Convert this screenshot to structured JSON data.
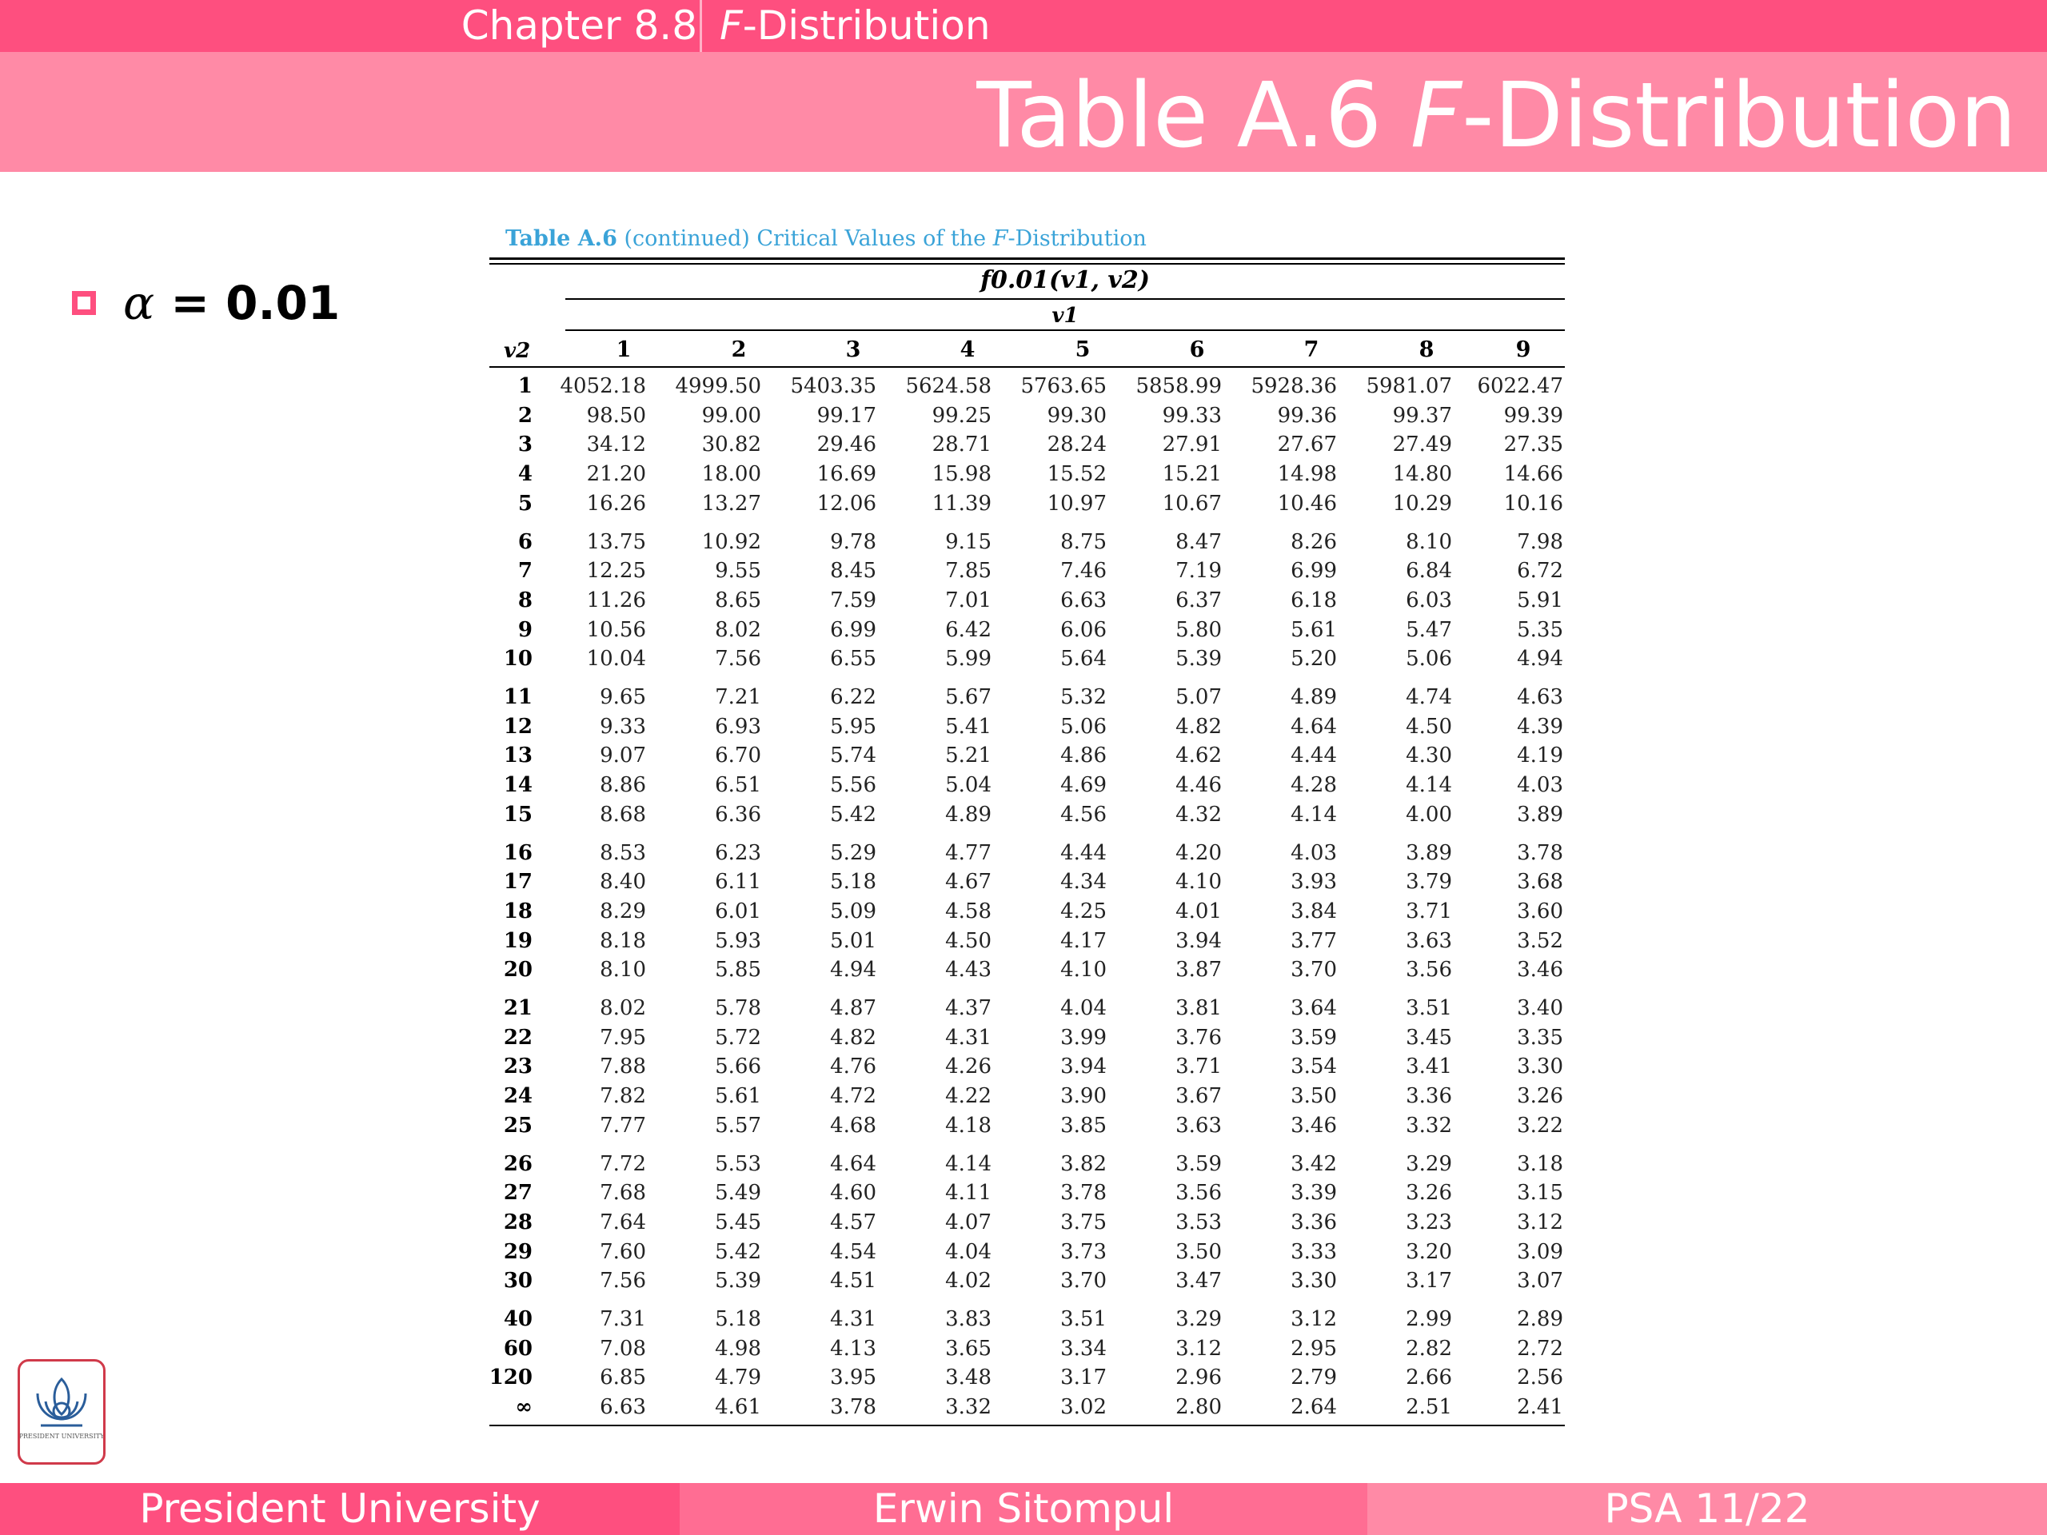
{
  "header": {
    "chapter": "Chapter 8.8",
    "topic_var": "F",
    "topic_rest": "-Distribution",
    "title_prefix": "Table A.6 ",
    "title_var": "F",
    "title_rest": "-Distribution"
  },
  "bullet": {
    "symbol": "α",
    "text": " = 0.01"
  },
  "table": {
    "caption_bold": "Table A.6",
    "caption_mid": " (continued) Critical Values of the ",
    "caption_var": "F",
    "caption_rest": "-Distribution",
    "f_header": "f0.01(v1, v2)",
    "v1_label": "v1",
    "v2_label": "v2",
    "columns": [
      "1",
      "2",
      "3",
      "4",
      "5",
      "6",
      "7",
      "8",
      "9"
    ],
    "rows": [
      {
        "v2": "1",
        "values": [
          "4052.18",
          "4999.50",
          "5403.35",
          "5624.58",
          "5763.65",
          "5858.99",
          "5928.36",
          "5981.07",
          "6022.47"
        ]
      },
      {
        "v2": "2",
        "values": [
          "98.50",
          "99.00",
          "99.17",
          "99.25",
          "99.30",
          "99.33",
          "99.36",
          "99.37",
          "99.39"
        ]
      },
      {
        "v2": "3",
        "values": [
          "34.12",
          "30.82",
          "29.46",
          "28.71",
          "28.24",
          "27.91",
          "27.67",
          "27.49",
          "27.35"
        ]
      },
      {
        "v2": "4",
        "values": [
          "21.20",
          "18.00",
          "16.69",
          "15.98",
          "15.52",
          "15.21",
          "14.98",
          "14.80",
          "14.66"
        ]
      },
      {
        "v2": "5",
        "values": [
          "16.26",
          "13.27",
          "12.06",
          "11.39",
          "10.97",
          "10.67",
          "10.46",
          "10.29",
          "10.16"
        ]
      },
      {
        "v2": "6",
        "values": [
          "13.75",
          "10.92",
          "9.78",
          "9.15",
          "8.75",
          "8.47",
          "8.26",
          "8.10",
          "7.98"
        ]
      },
      {
        "v2": "7",
        "values": [
          "12.25",
          "9.55",
          "8.45",
          "7.85",
          "7.46",
          "7.19",
          "6.99",
          "6.84",
          "6.72"
        ]
      },
      {
        "v2": "8",
        "values": [
          "11.26",
          "8.65",
          "7.59",
          "7.01",
          "6.63",
          "6.37",
          "6.18",
          "6.03",
          "5.91"
        ]
      },
      {
        "v2": "9",
        "values": [
          "10.56",
          "8.02",
          "6.99",
          "6.42",
          "6.06",
          "5.80",
          "5.61",
          "5.47",
          "5.35"
        ]
      },
      {
        "v2": "10",
        "values": [
          "10.04",
          "7.56",
          "6.55",
          "5.99",
          "5.64",
          "5.39",
          "5.20",
          "5.06",
          "4.94"
        ]
      },
      {
        "v2": "11",
        "values": [
          "9.65",
          "7.21",
          "6.22",
          "5.67",
          "5.32",
          "5.07",
          "4.89",
          "4.74",
          "4.63"
        ]
      },
      {
        "v2": "12",
        "values": [
          "9.33",
          "6.93",
          "5.95",
          "5.41",
          "5.06",
          "4.82",
          "4.64",
          "4.50",
          "4.39"
        ]
      },
      {
        "v2": "13",
        "values": [
          "9.07",
          "6.70",
          "5.74",
          "5.21",
          "4.86",
          "4.62",
          "4.44",
          "4.30",
          "4.19"
        ]
      },
      {
        "v2": "14",
        "values": [
          "8.86",
          "6.51",
          "5.56",
          "5.04",
          "4.69",
          "4.46",
          "4.28",
          "4.14",
          "4.03"
        ]
      },
      {
        "v2": "15",
        "values": [
          "8.68",
          "6.36",
          "5.42",
          "4.89",
          "4.56",
          "4.32",
          "4.14",
          "4.00",
          "3.89"
        ]
      },
      {
        "v2": "16",
        "values": [
          "8.53",
          "6.23",
          "5.29",
          "4.77",
          "4.44",
          "4.20",
          "4.03",
          "3.89",
          "3.78"
        ]
      },
      {
        "v2": "17",
        "values": [
          "8.40",
          "6.11",
          "5.18",
          "4.67",
          "4.34",
          "4.10",
          "3.93",
          "3.79",
          "3.68"
        ]
      },
      {
        "v2": "18",
        "values": [
          "8.29",
          "6.01",
          "5.09",
          "4.58",
          "4.25",
          "4.01",
          "3.84",
          "3.71",
          "3.60"
        ]
      },
      {
        "v2": "19",
        "values": [
          "8.18",
          "5.93",
          "5.01",
          "4.50",
          "4.17",
          "3.94",
          "3.77",
          "3.63",
          "3.52"
        ]
      },
      {
        "v2": "20",
        "values": [
          "8.10",
          "5.85",
          "4.94",
          "4.43",
          "4.10",
          "3.87",
          "3.70",
          "3.56",
          "3.46"
        ]
      },
      {
        "v2": "21",
        "values": [
          "8.02",
          "5.78",
          "4.87",
          "4.37",
          "4.04",
          "3.81",
          "3.64",
          "3.51",
          "3.40"
        ]
      },
      {
        "v2": "22",
        "values": [
          "7.95",
          "5.72",
          "4.82",
          "4.31",
          "3.99",
          "3.76",
          "3.59",
          "3.45",
          "3.35"
        ]
      },
      {
        "v2": "23",
        "values": [
          "7.88",
          "5.66",
          "4.76",
          "4.26",
          "3.94",
          "3.71",
          "3.54",
          "3.41",
          "3.30"
        ]
      },
      {
        "v2": "24",
        "values": [
          "7.82",
          "5.61",
          "4.72",
          "4.22",
          "3.90",
          "3.67",
          "3.50",
          "3.36",
          "3.26"
        ]
      },
      {
        "v2": "25",
        "values": [
          "7.77",
          "5.57",
          "4.68",
          "4.18",
          "3.85",
          "3.63",
          "3.46",
          "3.32",
          "3.22"
        ]
      },
      {
        "v2": "26",
        "values": [
          "7.72",
          "5.53",
          "4.64",
          "4.14",
          "3.82",
          "3.59",
          "3.42",
          "3.29",
          "3.18"
        ]
      },
      {
        "v2": "27",
        "values": [
          "7.68",
          "5.49",
          "4.60",
          "4.11",
          "3.78",
          "3.56",
          "3.39",
          "3.26",
          "3.15"
        ]
      },
      {
        "v2": "28",
        "values": [
          "7.64",
          "5.45",
          "4.57",
          "4.07",
          "3.75",
          "3.53",
          "3.36",
          "3.23",
          "3.12"
        ]
      },
      {
        "v2": "29",
        "values": [
          "7.60",
          "5.42",
          "4.54",
          "4.04",
          "3.73",
          "3.50",
          "3.33",
          "3.20",
          "3.09"
        ]
      },
      {
        "v2": "30",
        "values": [
          "7.56",
          "5.39",
          "4.51",
          "4.02",
          "3.70",
          "3.47",
          "3.30",
          "3.17",
          "3.07"
        ]
      },
      {
        "v2": "40",
        "values": [
          "7.31",
          "5.18",
          "4.31",
          "3.83",
          "3.51",
          "3.29",
          "3.12",
          "2.99",
          "2.89"
        ]
      },
      {
        "v2": "60",
        "values": [
          "7.08",
          "4.98",
          "4.13",
          "3.65",
          "3.34",
          "3.12",
          "2.95",
          "2.82",
          "2.72"
        ]
      },
      {
        "v2": "120",
        "values": [
          "6.85",
          "4.79",
          "3.95",
          "3.48",
          "3.17",
          "2.96",
          "2.79",
          "2.66",
          "2.56"
        ]
      },
      {
        "v2": "∞",
        "values": [
          "6.63",
          "4.61",
          "3.78",
          "3.32",
          "3.02",
          "2.80",
          "2.64",
          "2.51",
          "2.41"
        ]
      }
    ]
  },
  "logo": {
    "text": "PRESIDENT UNIVERSITY",
    "icon": "lotus-logo-icon"
  },
  "footer": {
    "left": "President University",
    "center": "Erwin Sitompul",
    "right": "PSA 11/22"
  },
  "colors": {
    "primary": "#fe4f7f",
    "secondary": "#ff8aa6",
    "caption": "#3aa3d8",
    "logo_red": "#d03a4a",
    "logo_blue": "#2a5d9a"
  }
}
